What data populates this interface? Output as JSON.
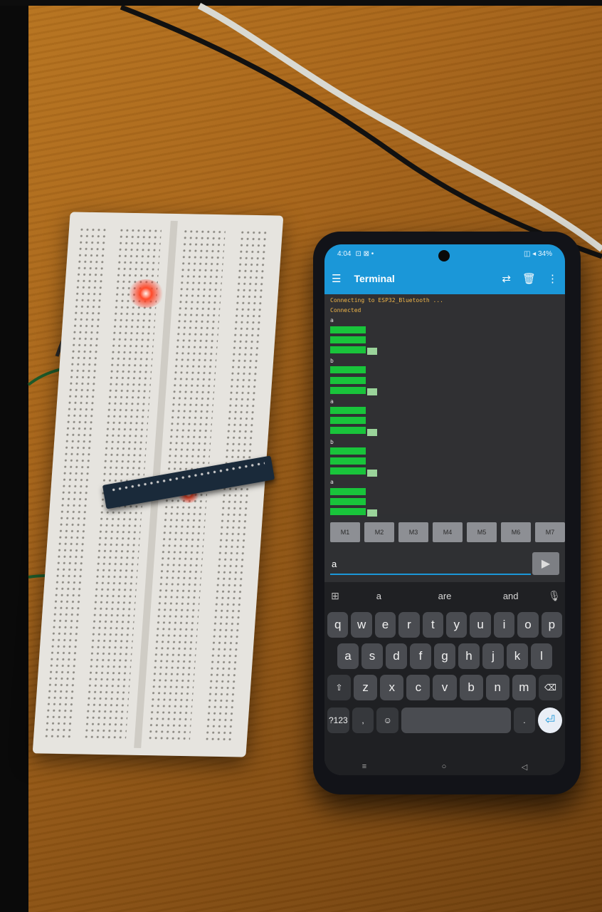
{
  "status_bar": {
    "time": "4:04",
    "left_info": "⊡ ⊠ •",
    "right_info": "◫ ◂ 34%"
  },
  "app_bar": {
    "title": "Terminal",
    "menu_icon": "menu-icon",
    "actions": [
      "connect-icon",
      "delete-icon",
      "more-icon"
    ]
  },
  "terminal": {
    "lines": [
      {
        "ts": "",
        "text": "Connecting to ESP32_Bluetooth ...",
        "kind": "info"
      },
      {
        "ts": "",
        "text": "Connected",
        "kind": "info"
      },
      {
        "ts": "",
        "text": "a",
        "kind": "sent"
      },
      {
        "ts": "",
        "text": "",
        "kind": "recv"
      },
      {
        "ts": "",
        "text": "",
        "kind": "recv"
      },
      {
        "ts": "",
        "text": "",
        "kind": "recv-box"
      },
      {
        "ts": "",
        "text": "b",
        "kind": "sent"
      },
      {
        "ts": "",
        "text": "",
        "kind": "recv"
      },
      {
        "ts": "",
        "text": "",
        "kind": "recv"
      },
      {
        "ts": "",
        "text": "",
        "kind": "recv-box"
      },
      {
        "ts": "",
        "text": "a",
        "kind": "sent"
      },
      {
        "ts": "",
        "text": "",
        "kind": "recv"
      },
      {
        "ts": "",
        "text": "",
        "kind": "recv"
      },
      {
        "ts": "",
        "text": "",
        "kind": "recv-box"
      },
      {
        "ts": "",
        "text": "b",
        "kind": "sent"
      },
      {
        "ts": "",
        "text": "",
        "kind": "recv"
      },
      {
        "ts": "",
        "text": "",
        "kind": "recv"
      },
      {
        "ts": "",
        "text": "",
        "kind": "recv-box"
      },
      {
        "ts": "",
        "text": "a",
        "kind": "sent"
      },
      {
        "ts": "",
        "text": "",
        "kind": "recv"
      },
      {
        "ts": "",
        "text": "",
        "kind": "recv"
      },
      {
        "ts": "",
        "text": "",
        "kind": "recv-box"
      }
    ]
  },
  "macro_buttons": [
    "M1",
    "M2",
    "M3",
    "M4",
    "M5",
    "M6",
    "M7"
  ],
  "input": {
    "value": "a",
    "send_icon": "send-icon"
  },
  "keyboard": {
    "suggestions": [
      "a",
      "are",
      "and"
    ],
    "row1": [
      "q",
      "w",
      "e",
      "r",
      "t",
      "y",
      "u",
      "i",
      "o",
      "p"
    ],
    "row2": [
      "a",
      "s",
      "d",
      "f",
      "g",
      "h",
      "j",
      "k",
      "l"
    ],
    "row3": [
      "⇧",
      "z",
      "x",
      "c",
      "v",
      "b",
      "n",
      "m",
      "⌫"
    ],
    "row4": {
      "symbols": "?123",
      "comma": ",",
      "emoji": "☺",
      "space": "",
      "period": ".",
      "enter": "⏎"
    },
    "nav": [
      "≡",
      "○",
      "◁"
    ]
  },
  "colors": {
    "accent": "#1b97d8",
    "recv_bg": "#19c43b",
    "info_text": "#f0b64a",
    "desk": "#a9661a"
  }
}
